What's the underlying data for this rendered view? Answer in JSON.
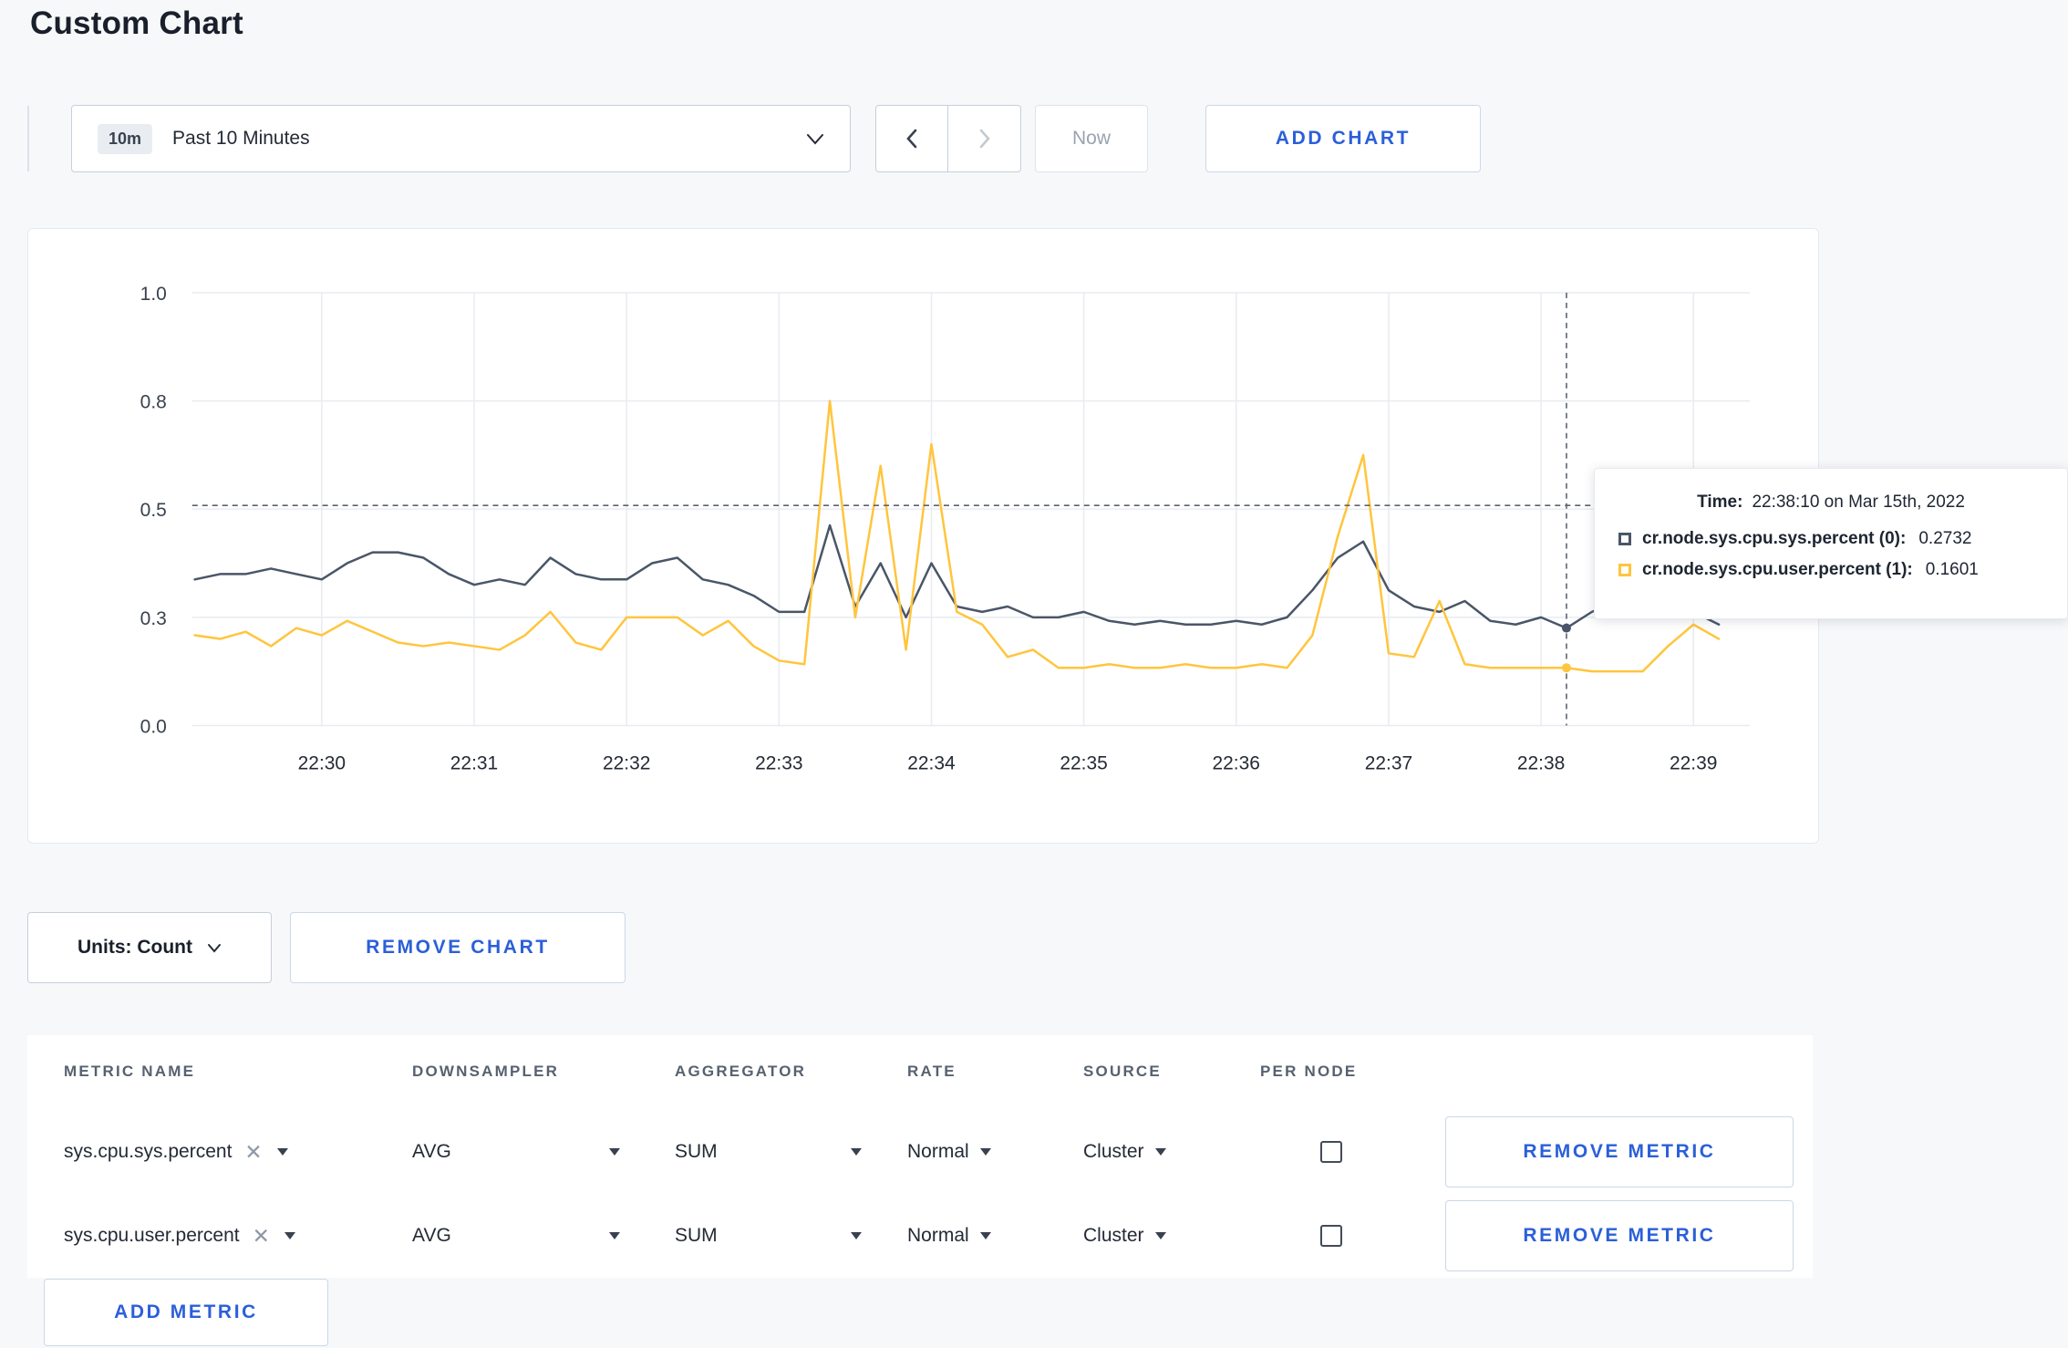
{
  "page": {
    "title": "Custom Chart"
  },
  "colors": {
    "accent": "#2b5fd9",
    "series_sys": "#4a5668",
    "series_user": "#ffc53d",
    "grid": "#e8ebf0",
    "crosshair": "#5b6470"
  },
  "toolbar": {
    "time_range": {
      "badge": "10m",
      "label": "Past 10 Minutes"
    },
    "now_label": "Now",
    "add_chart_label": "ADD CHART"
  },
  "chart": {
    "tooltip": {
      "time_label": "Time:",
      "time_value": "22:38:10 on Mar 15th, 2022",
      "series": [
        {
          "name": "cr.node.sys.cpu.sys.percent (0):",
          "value": "0.2732",
          "color": "#4a5668"
        },
        {
          "name": "cr.node.sys.cpu.user.percent (1):",
          "value": "0.1601",
          "color": "#ffc53d"
        }
      ]
    }
  },
  "chart_data": {
    "type": "line",
    "title": "",
    "xlabel": "",
    "ylabel": "",
    "y_ticks": [
      0.0,
      0.3,
      0.5,
      0.8,
      1.0
    ],
    "x_ticks": [
      "22:30",
      "22:31",
      "22:32",
      "22:33",
      "22:34",
      "22:35",
      "22:36",
      "22:37",
      "22:38",
      "22:39"
    ],
    "x_domain": [
      -0.85,
      9.37
    ],
    "t_start": -0.8333,
    "t_step": 0.16667,
    "interval_seconds": 10,
    "grid": true,
    "legend": "tooltip-only",
    "crosshair": {
      "index": 54,
      "t": 8.1667,
      "time": "22:38:10",
      "hline_value": 0.51
    },
    "series": [
      {
        "name": "cr.node.sys.cpu.sys.percent",
        "color": "#4a5668",
        "values": [
          0.37,
          0.38,
          0.38,
          0.39,
          0.38,
          0.37,
          0.4,
          0.42,
          0.42,
          0.41,
          0.38,
          0.36,
          0.37,
          0.36,
          0.41,
          0.38,
          0.37,
          0.37,
          0.4,
          0.41,
          0.37,
          0.36,
          0.34,
          0.31,
          0.31,
          0.47,
          0.32,
          0.4,
          0.3,
          0.4,
          0.32,
          0.31,
          0.32,
          0.3,
          0.3,
          0.31,
          0.29,
          0.28,
          0.29,
          0.28,
          0.28,
          0.29,
          0.28,
          0.3,
          0.35,
          0.41,
          0.44,
          0.35,
          0.32,
          0.31,
          0.33,
          0.29,
          0.28,
          0.3,
          0.27,
          0.31,
          0.33,
          0.31,
          0.3,
          0.31,
          0.28
        ]
      },
      {
        "name": "cr.node.sys.cpu.user.percent",
        "color": "#ffc53d",
        "values": [
          0.25,
          0.24,
          0.26,
          0.22,
          0.27,
          0.25,
          0.29,
          0.26,
          0.23,
          0.22,
          0.23,
          0.22,
          0.21,
          0.25,
          0.31,
          0.23,
          0.21,
          0.3,
          0.3,
          0.3,
          0.25,
          0.29,
          0.22,
          0.18,
          0.17,
          0.8,
          0.3,
          0.62,
          0.21,
          0.68,
          0.31,
          0.28,
          0.19,
          0.21,
          0.16,
          0.16,
          0.17,
          0.16,
          0.16,
          0.17,
          0.16,
          0.16,
          0.17,
          0.16,
          0.25,
          0.45,
          0.65,
          0.2,
          0.19,
          0.33,
          0.17,
          0.16,
          0.16,
          0.16,
          0.16,
          0.15,
          0.15,
          0.15,
          0.22,
          0.28,
          0.24
        ]
      }
    ]
  },
  "controls": {
    "units_label": "Units: Count",
    "remove_chart_label": "REMOVE CHART",
    "add_metric_label": "ADD METRIC"
  },
  "metrics_table": {
    "headers": [
      "METRIC NAME",
      "DOWNSAMPLER",
      "AGGREGATOR",
      "RATE",
      "SOURCE",
      "PER NODE"
    ],
    "rows": [
      {
        "metric": "sys.cpu.sys.percent",
        "downsampler": "AVG",
        "aggregator": "SUM",
        "rate": "Normal",
        "source": "Cluster",
        "per_node_checked": false,
        "remove_label": "REMOVE METRIC"
      },
      {
        "metric": "sys.cpu.user.percent",
        "downsampler": "AVG",
        "aggregator": "SUM",
        "rate": "Normal",
        "source": "Cluster",
        "per_node_checked": false,
        "remove_label": "REMOVE METRIC"
      }
    ]
  }
}
